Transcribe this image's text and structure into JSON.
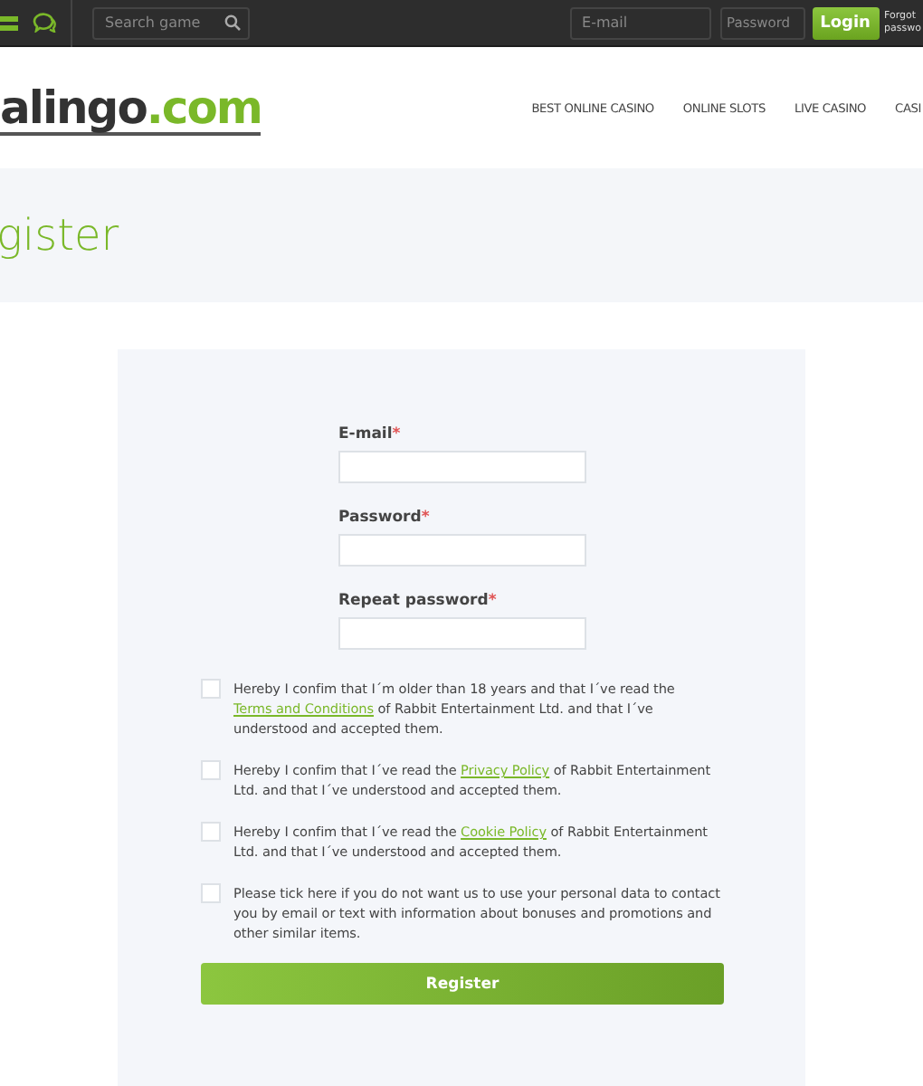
{
  "top_bar": {
    "search": {
      "placeholder": "Search game"
    },
    "email": {
      "placeholder": "E-mail"
    },
    "password": {
      "placeholder": "Password"
    },
    "login_button": "Login",
    "forgot_link": [
      "Forgot",
      "passwo"
    ]
  },
  "header": {
    "logo": {
      "name": "alingo",
      ".com": ".com"
    },
    "nav": [
      "BEST ONLINE CASINO",
      "ONLINE SLOTS",
      "LIVE CASINO",
      "CASI"
    ]
  },
  "page_title": "gister",
  "form": {
    "fields": [
      {
        "label": "E-mail",
        "required": true,
        "required_mark": "*"
      },
      {
        "label": "Password",
        "required": true,
        "required_mark": "*"
      },
      {
        "label": "Repeat password",
        "required": true,
        "required_mark": "*"
      }
    ],
    "consents": [
      {
        "checked": false,
        "before": "Hereby I confim that I´m older than 18 years and that I´ve read the ",
        "link": "Terms and Conditions",
        "after": " of Rabbit Entertainment Ltd. and that I´ve understood and accepted them."
      },
      {
        "checked": false,
        "before": "Hereby I confim that I´ve read the ",
        "link": "Privacy Policy",
        "after": " of Rabbit Entertainment Ltd. and that I´ve understood and accepted them."
      },
      {
        "checked": false,
        "before": "Hereby I confim that I´ve read the ",
        "link": "Cookie Policy",
        "after": " of Rabbit Entertainment Ltd. and that I´ve understood and accepted them."
      },
      {
        "checked": false,
        "before": "Please tick here if you do not want us to use your personal data to contact you by email or text with information about bonuses and promotions and other similar items."
      }
    ],
    "submit": "Register"
  }
}
